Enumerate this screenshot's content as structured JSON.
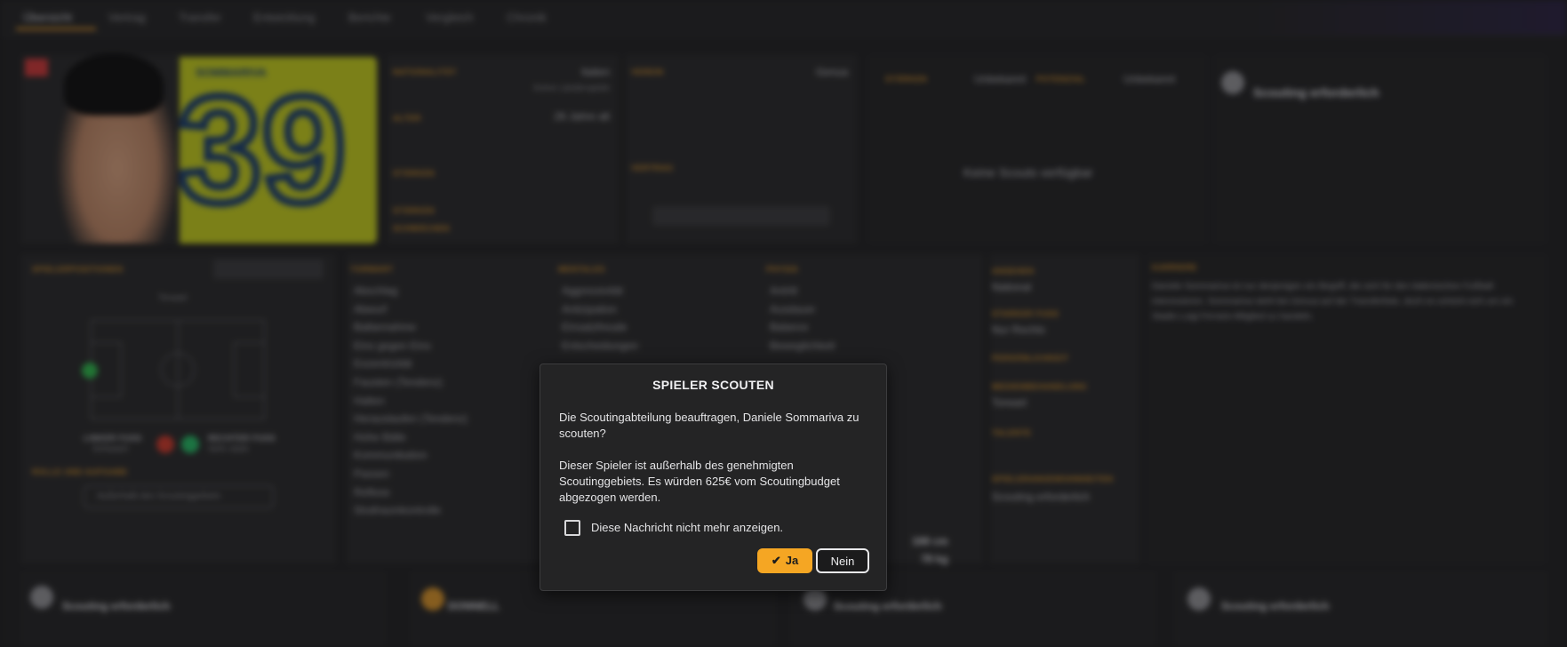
{
  "modal": {
    "title": "SPIELER SCOUTEN",
    "paragraph1": "Die Scoutingabteilung beauftragen, Daniele Sommariva zu scouten?",
    "paragraph2": "Dieser Spieler ist außerhalb des genehmigten Scoutinggebiets. Es würden 625€ vom Scoutingbudget abgezogen werden.",
    "checkbox_label": "Diese Nachricht nicht mehr anzeigen.",
    "checkbox_checked": false,
    "yes_label": "Ja",
    "no_label": "Nein",
    "yes_icon": "checkmark-icon"
  },
  "background": {
    "tabs": [
      "Übersicht",
      "Vertrag",
      "Transfer",
      "Entwicklung",
      "Berichte",
      "Vergleich",
      "Chronik"
    ],
    "player_surname": "SOMMARIVA",
    "shirt_number": "39",
    "info": {
      "nationality_label": "NATIONALITÄT",
      "nationality_value": "Italien",
      "nationality_sub": "Keine Länderspiele",
      "age_label": "ALTER",
      "age_value": "26 Jahre alt",
      "club_label": "VEREIN",
      "club_value": "Genua",
      "contract_label": "VERTRAG",
      "status_label": "STÄRKEN",
      "weak_label": "SCHWÄCHEN"
    },
    "unknown": "Unbekannt",
    "potential_label": "POTENZIAL",
    "no_scouts": "Keine Scouts verfügbar",
    "scouting_required": "Scouting erforderlich",
    "positions_label": "SPIELERPOSITIONEN",
    "position_value": "Torwart",
    "left_foot_label": "LINKER FUSS",
    "left_foot_value": "Schwach",
    "right_foot_label": "RECHTER FUSS",
    "right_foot_value": "Sehr stark",
    "role_label": "ROLLE UND AUFGABE",
    "role_value": "Außerhalb des Scoutinggebiets",
    "technical_label": "TORWART",
    "mental_label": "MENTALES",
    "physical_label": "PHYSIS",
    "tech_rows": [
      "Abschlag",
      "Abwurf",
      "Ballannahme",
      "Eins gegen Eins",
      "Exzentrizität",
      "Fausten (Tendenz)",
      "Halten",
      "Herauslaufen (Tendenz)",
      "Hohe Bälle",
      "Kommunikation",
      "Passen",
      "Reflexe",
      "Strafraumkontrolle"
    ],
    "mental_rows": [
      "Aggressivität",
      "Antizipation",
      "Einsatzfreude",
      "Entscheidungen"
    ],
    "physical_rows": [
      "Antritt",
      "Ausdauer",
      "Balance",
      "Beweglichkeit"
    ],
    "height": "188 cm",
    "weight": "78 kg",
    "right_labels": [
      "ANSEHEN",
      "STARKER FUSS",
      "PERSÖNLICHKEIT",
      "MEDIENBEHANDLUNG",
      "TALENTE",
      "SPIELERANGEWOHNHEITEN"
    ],
    "right_values": [
      "National",
      "Nur Rechts",
      "Torwart",
      "Scouting erforderlich"
    ],
    "bio_label": "KARRIERE",
    "bio": "Daniele Sommariva ist nur denjenigen ein Begriff, die sich für den italienischen Fußball interessieren. Sommariva steht bei Genua auf der Transferliste, doch es scheint sich um ein Stadio Luigi Ferraris-Mitglied zu handeln.",
    "bottom_cards": [
      "Scouting erforderlich",
      "DONNELL",
      "Scouting erforderlich",
      "Scouting erforderlich"
    ]
  },
  "colors": {
    "accent": "#f5a623",
    "label_orange": "#c98a2a",
    "modal_bg": "#242425"
  }
}
